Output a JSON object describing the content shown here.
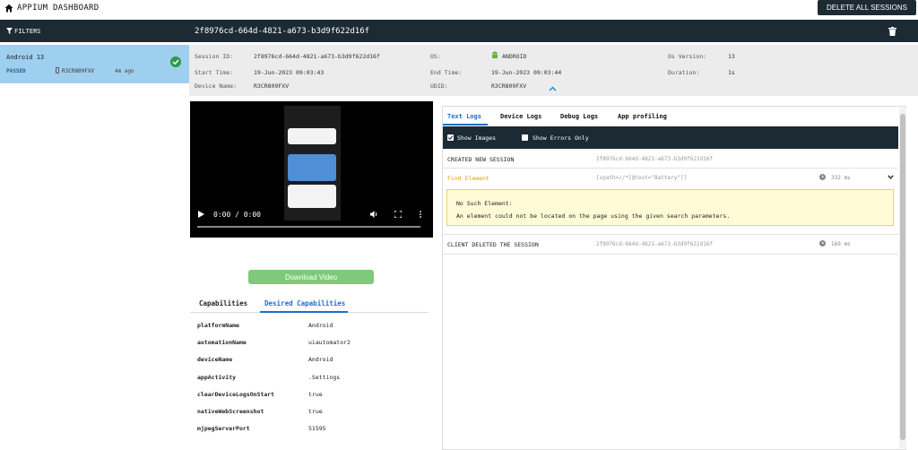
{
  "app": {
    "title": "APPIUM DASHBOARD",
    "delete_all_label": "DELETE ALL SESSIONS"
  },
  "sidebar": {
    "filters_label": "FILTERS",
    "sessions": [
      {
        "name": "Android 13",
        "status": "PASSED",
        "device": "R3CR809FXV",
        "time": "4m ago"
      }
    ]
  },
  "session": {
    "id": "2f8976cd-664d-4821-a673-b3d9f622d16f",
    "meta": {
      "session_id_label": "Session ID:",
      "session_id": "2f8976cd-664d-4821-a673-b3d9f622d16f",
      "os_label": "OS:",
      "os": "ANDROID",
      "os_version_label": "Os Version:",
      "os_version": "13",
      "start_label": "Start Time:",
      "start": "19-Jun-2023 09:03:43",
      "end_label": "End Time:",
      "end": "19-Jun-2023 09:03:44",
      "duration_label": "Duration:",
      "duration": "1s",
      "device_label": "Device Name:",
      "device": "R3CR809FXV",
      "udid_label": "UDID:",
      "udid": "R3CR809FXV"
    }
  },
  "video": {
    "time": "0:00 / 0:00",
    "download_label": "Download Video"
  },
  "capabilities": {
    "tabs": [
      "Capabilities",
      "Desired Capabilities"
    ],
    "active_tab": "Desired Capabilities",
    "rows": [
      {
        "key": "platformName",
        "value": "Android"
      },
      {
        "key": "automationName",
        "value": "uiautomator2"
      },
      {
        "key": "deviceName",
        "value": "Android"
      },
      {
        "key": "appActivity",
        "value": ".Settings"
      },
      {
        "key": "clearDeviceLogsOnStart",
        "value": "true"
      },
      {
        "key": "nativeWebScreenshot",
        "value": "true"
      },
      {
        "key": "mjpegServerPort",
        "value": "51595"
      }
    ]
  },
  "logs": {
    "tabs": [
      "Text Logs",
      "Device Logs",
      "Debug Logs",
      "App profiling"
    ],
    "active_tab": "Text Logs",
    "show_images_label": "Show Images",
    "show_errors_label": "Show Errors Only",
    "show_images_checked": true,
    "show_errors_checked": false,
    "entries": [
      {
        "command": "CREATED NEW SESSION",
        "detail": "2f8976cd-664d-4821-a673-b3d9f622d16f",
        "duration": ""
      },
      {
        "command": "Find Element",
        "detail": "[xpath=//*[@text=\"Battery\"]]",
        "duration": "332 ms"
      },
      {
        "command": "CLIENT DELETED THE SESSION",
        "detail": "2f8976cd-664d-4821-a673-b3d9f622d16f",
        "duration": "169 ms"
      }
    ],
    "error": {
      "title": "No Such Element:",
      "message": "An element could not be located on the page using the given search parameters."
    }
  },
  "colors": {
    "dark": "#1c2b33",
    "selected": "#9fcfee",
    "accent": "#1a6ed8",
    "success": "#2e9b48",
    "warning": "#e0a100",
    "download": "#7ec97a"
  }
}
